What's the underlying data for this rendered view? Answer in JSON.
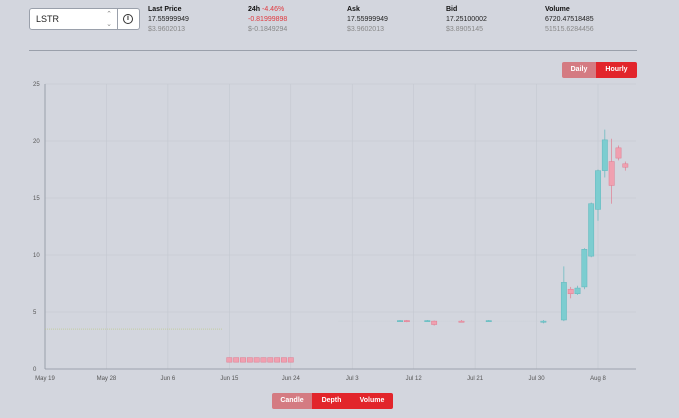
{
  "ticker": {
    "selected": "LSTR",
    "arrows": "⌃⌄",
    "info_icon": "i"
  },
  "stats": [
    {
      "label": "Last Price",
      "value": "17.55999949",
      "sub": "$3.9602013"
    },
    {
      "label": "24h",
      "change": "-4.46%",
      "value": "-0.81999898",
      "sub": "$-0.1849294"
    },
    {
      "label": "Ask",
      "value": "17.55999949",
      "sub": "$3.9602013"
    },
    {
      "label": "Bid",
      "value": "17.25100002",
      "sub": "$3.8905145"
    },
    {
      "label": "Volume",
      "value": "6720.47518485",
      "sub": "51515.6284456"
    }
  ],
  "interval": {
    "daily": "Daily",
    "hourly": "Hourly",
    "active": "hourly"
  },
  "views": {
    "candle": "Candle",
    "depth": "Depth",
    "volume": "Volume",
    "active": "candle"
  },
  "colors": {
    "up": "#7ccdd0",
    "up_border": "#5fb8bd",
    "down": "#f0a0b0",
    "down_border": "#e07c90",
    "grid": "#c4c8d0"
  },
  "chart_data": {
    "type": "candlestick",
    "ylim": [
      0,
      25
    ],
    "yticks": [
      "0",
      "5",
      "10",
      "15",
      "20",
      "25"
    ],
    "xticks": [
      "May 19",
      "May 28",
      "Jun 6",
      "Jun 15",
      "Jun 24",
      "Jul 3",
      "Jul 12",
      "Jul 21",
      "Jul 30",
      "Aug 8"
    ],
    "candles": [
      {
        "date": "Jun 15",
        "open": 1.0,
        "high": 1.0,
        "low": 0.6,
        "close": 0.6
      },
      {
        "date": "Jun 16",
        "open": 1.0,
        "high": 1.0,
        "low": 0.6,
        "close": 0.6
      },
      {
        "date": "Jun 17",
        "open": 1.0,
        "high": 1.0,
        "low": 0.6,
        "close": 0.6
      },
      {
        "date": "Jun 18",
        "open": 1.0,
        "high": 1.0,
        "low": 0.6,
        "close": 0.6
      },
      {
        "date": "Jun 19",
        "open": 1.0,
        "high": 1.0,
        "low": 0.6,
        "close": 0.6
      },
      {
        "date": "Jun 20",
        "open": 1.0,
        "high": 1.0,
        "low": 0.6,
        "close": 0.6
      },
      {
        "date": "Jun 21",
        "open": 1.0,
        "high": 1.0,
        "low": 0.6,
        "close": 0.6
      },
      {
        "date": "Jun 22",
        "open": 1.0,
        "high": 1.0,
        "low": 0.6,
        "close": 0.6
      },
      {
        "date": "Jun 23",
        "open": 1.0,
        "high": 1.0,
        "low": 0.6,
        "close": 0.6
      },
      {
        "date": "Jun 24",
        "open": 1.0,
        "high": 1.0,
        "low": 0.6,
        "close": 0.6
      },
      {
        "date": "Jul 10",
        "open": 4.2,
        "high": 4.3,
        "low": 4.2,
        "close": 4.25
      },
      {
        "date": "Jul 11",
        "open": 4.25,
        "high": 4.3,
        "low": 4.1,
        "close": 4.2
      },
      {
        "date": "Jul 14",
        "open": 4.2,
        "high": 4.3,
        "low": 4.2,
        "close": 4.25
      },
      {
        "date": "Jul 15",
        "open": 4.2,
        "high": 4.25,
        "low": 3.8,
        "close": 3.9
      },
      {
        "date": "Jul 19",
        "open": 4.2,
        "high": 4.3,
        "low": 4.1,
        "close": 4.15
      },
      {
        "date": "Jul 23",
        "open": 4.2,
        "high": 4.3,
        "low": 4.2,
        "close": 4.25
      },
      {
        "date": "Jul 31",
        "open": 4.1,
        "high": 4.3,
        "low": 4.0,
        "close": 4.2
      },
      {
        "date": "Aug 3",
        "open": 4.3,
        "high": 9.0,
        "low": 4.2,
        "close": 7.6
      },
      {
        "date": "Aug 4",
        "open": 7.0,
        "high": 7.2,
        "low": 6.2,
        "close": 6.6
      },
      {
        "date": "Aug 5",
        "open": 6.6,
        "high": 7.3,
        "low": 6.5,
        "close": 7.1
      },
      {
        "date": "Aug 6",
        "open": 7.2,
        "high": 10.6,
        "low": 7.0,
        "close": 10.5
      },
      {
        "date": "Aug 7",
        "open": 9.9,
        "high": 14.6,
        "low": 9.8,
        "close": 14.5
      },
      {
        "date": "Aug 8",
        "open": 14.0,
        "high": 17.5,
        "low": 13.0,
        "close": 17.4
      },
      {
        "date": "Aug 9",
        "open": 17.4,
        "high": 21.0,
        "low": 16.8,
        "close": 20.1
      },
      {
        "date": "Aug 10",
        "open": 18.2,
        "high": 20.2,
        "low": 14.5,
        "close": 16.1
      },
      {
        "date": "Aug 11",
        "open": 19.4,
        "high": 19.6,
        "low": 18.3,
        "close": 18.5
      },
      {
        "date": "Aug 12",
        "open": 18.0,
        "high": 18.2,
        "low": 17.4,
        "close": 17.7
      }
    ]
  }
}
